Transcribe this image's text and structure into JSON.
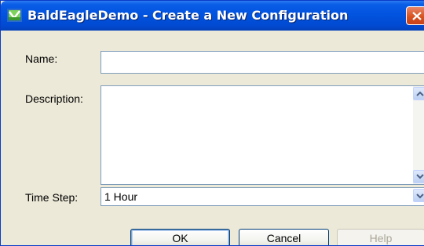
{
  "window": {
    "title": "BaldEagleDemo - Create a New Configuration"
  },
  "form": {
    "name_label": "Name:",
    "name_value": "",
    "description_label": "Description:",
    "description_value": "",
    "time_step_label": "Time Step:",
    "time_step_value": "1 Hour"
  },
  "buttons": {
    "ok": "OK",
    "cancel": "Cancel",
    "help": "Help"
  },
  "icons": {
    "app": "app-icon",
    "close": "close-icon",
    "scroll_up": "arrow-up-icon",
    "scroll_down": "arrow-down-icon",
    "dropdown": "chevron-down-icon"
  },
  "colors": {
    "titlebar": "#0254e0",
    "dialog_bg": "#ece9d8",
    "close_button": "#d9531f",
    "field_border": "#7f9db9"
  }
}
